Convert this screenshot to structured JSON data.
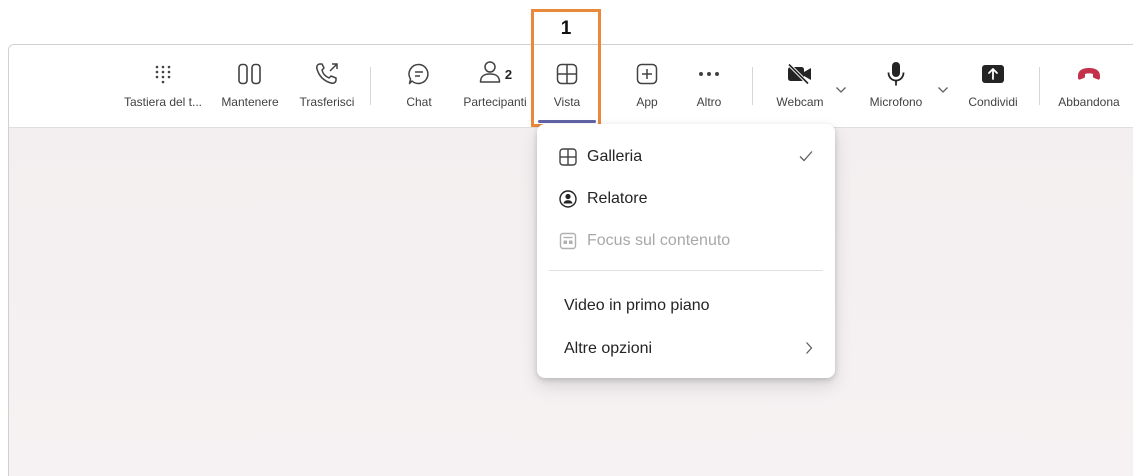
{
  "toolbar": {
    "keypad_label": "Tastiera del t...",
    "hold_label": "Mantenere",
    "transfer_label": "Trasferisci",
    "chat_label": "Chat",
    "participants_label": "Partecipanti",
    "participants_count": "2",
    "view_label": "Vista",
    "apps_label": "App",
    "more_label": "Altro",
    "camera_label": "Webcam",
    "mic_label": "Microfono",
    "share_label": "Condividi",
    "leave_label": "Abbandona"
  },
  "annotation": {
    "step_number": "1"
  },
  "view_menu": {
    "gallery_label": "Galleria",
    "speaker_label": "Relatore",
    "content_focus_label": "Focus sul contenuto",
    "spotlight_label": "Video in primo piano",
    "more_options_label": "Altre opzioni",
    "selected": "Galleria"
  },
  "colors": {
    "accent": "#6264a7",
    "annotation": "#e8893b",
    "leave": "#c4314b"
  }
}
